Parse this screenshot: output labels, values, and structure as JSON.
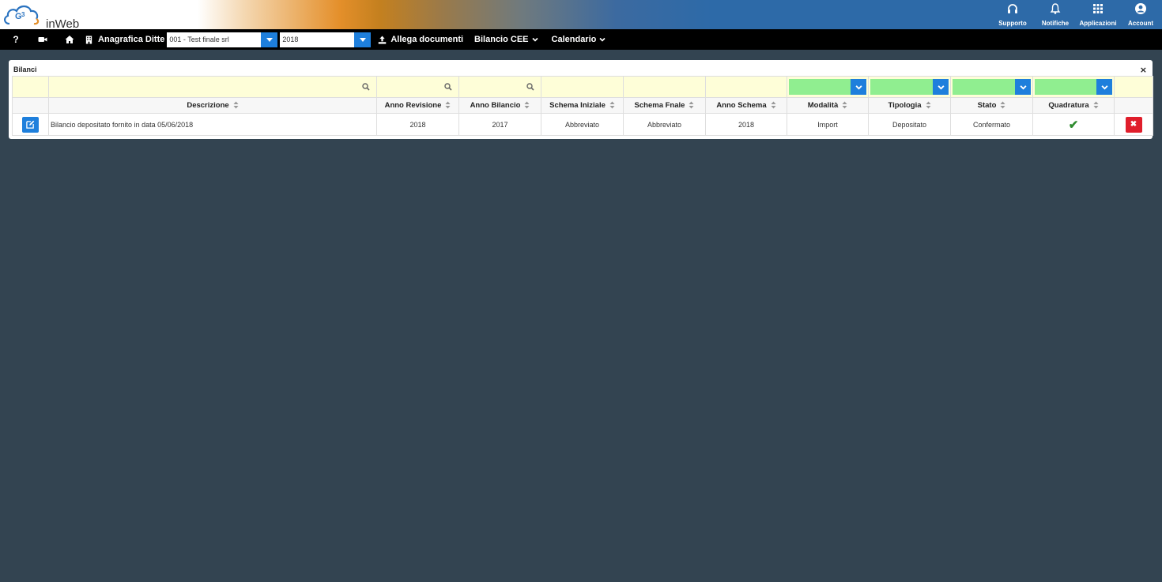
{
  "brand": {
    "logo_text": "inWeb"
  },
  "top_menu": [
    {
      "label": "Supporto",
      "icon": "headphones-icon"
    },
    {
      "label": "Notifiche",
      "icon": "bell-icon"
    },
    {
      "label": "Applicazioni",
      "icon": "grid-icon"
    },
    {
      "label": "Account",
      "icon": "user-circle-icon"
    }
  ],
  "navbar": {
    "help_label": "?",
    "anagrafica_label": "Anagrafica Ditte",
    "company_select": {
      "value": "001 - Test finale srl"
    },
    "year_select": {
      "value": "2018"
    },
    "allega_label": "Allega documenti",
    "bilancio_label": "Bilancio CEE",
    "calendario_label": "Calendario"
  },
  "panel": {
    "title": "Bilanci",
    "close_label": "×",
    "columns": [
      "Descrizione",
      "Anno Revisione",
      "Anno Bilancio",
      "Schema Iniziale",
      "Schema Fnale",
      "Anno Schema",
      "Modalità",
      "Tipologia",
      "Stato",
      "Quadratura"
    ],
    "rows": [
      {
        "descrizione": "Bilancio depositato fornito in data 05/06/2018",
        "anno_revisione": "2018",
        "anno_bilancio": "2017",
        "schema_iniziale": "Abbreviato",
        "schema_finale": "Abbreviato",
        "anno_schema": "2018",
        "modalita": "Import",
        "tipologia": "Depositato",
        "stato": "Confermato",
        "quadratura": "✔",
        "delete_label": "✖"
      }
    ]
  },
  "colors": {
    "accent": "#1e7fdc",
    "danger": "#e01e2b",
    "filter_bg": "#fefed8",
    "select_green": "#90ee90",
    "page_bg": "#334451",
    "check": "#2e8b2e"
  }
}
